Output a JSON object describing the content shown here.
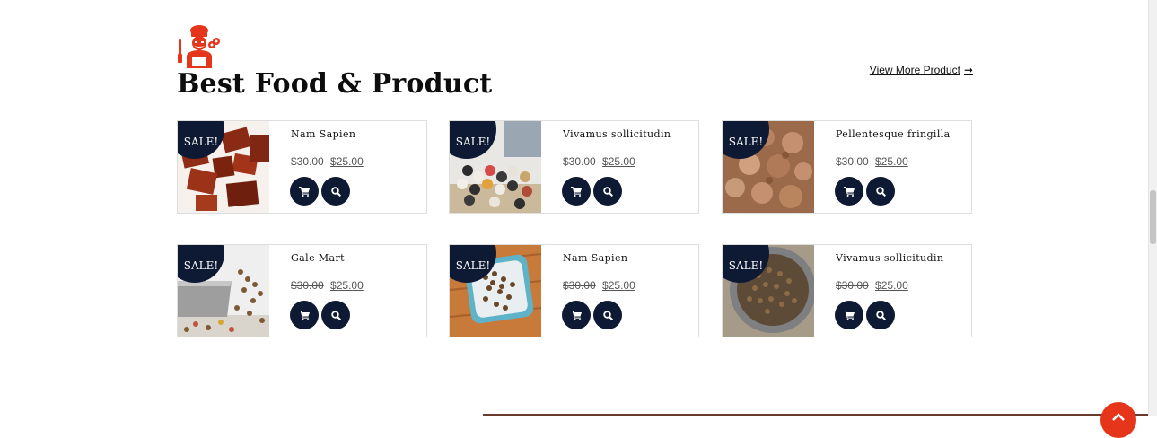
{
  "section": {
    "title": "Best Food & Product",
    "view_more": "View More Product",
    "view_more_arrow": "➞"
  },
  "colors": {
    "badge": "#0e1a33",
    "accent": "#e5361b",
    "border": "#dedede"
  },
  "products": [
    {
      "name": "Nam Sapien",
      "badge": "SALE!",
      "old_price": "$30.00",
      "new_price": "$25.00"
    },
    {
      "name": "Vivamus sollicitudin",
      "badge": "SALE!",
      "old_price": "$30.00",
      "new_price": "$25.00"
    },
    {
      "name": "Pellentesque fringilla",
      "badge": "SALE!",
      "old_price": "$30.00",
      "new_price": "$25.00"
    },
    {
      "name": "Gale Mart",
      "badge": "SALE!",
      "old_price": "$30.00",
      "new_price": "$25.00"
    },
    {
      "name": "Nam Sapien",
      "badge": "SALE!",
      "old_price": "$30.00",
      "new_price": "$25.00"
    },
    {
      "name": "Vivamus sollicitudin",
      "badge": "SALE!",
      "old_price": "$30.00",
      "new_price": "$25.00"
    }
  ],
  "icons": {
    "cart": "cart-icon",
    "search": "search-icon",
    "chef": "chef-icon",
    "to_top": "chevron-up-icon"
  }
}
